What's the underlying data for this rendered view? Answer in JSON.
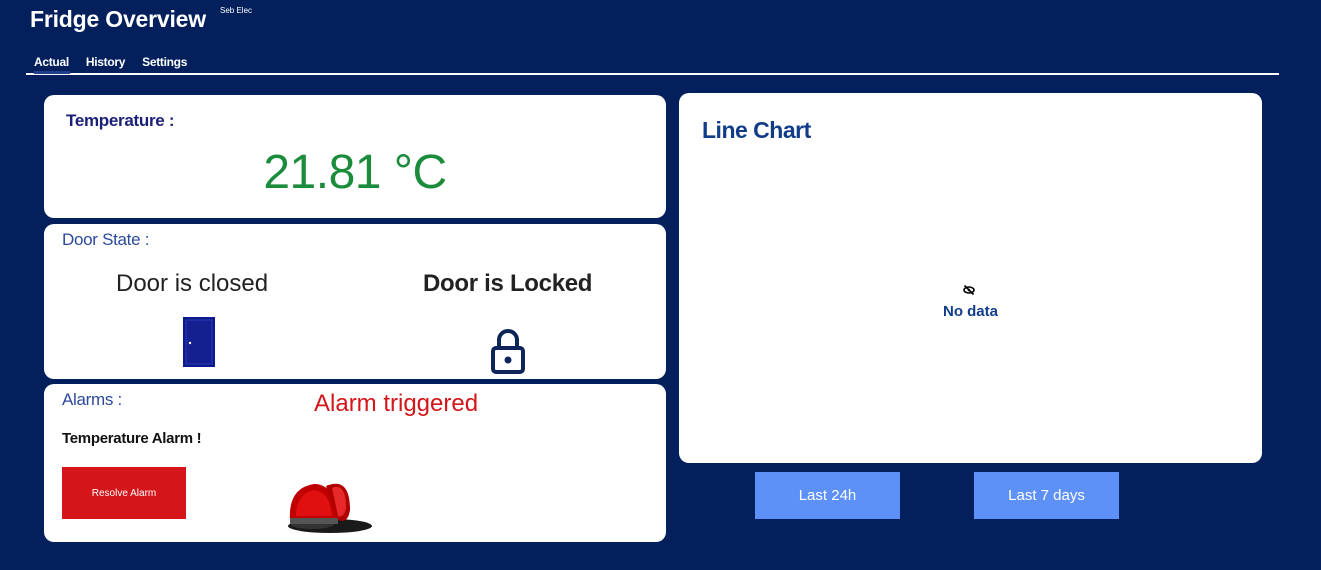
{
  "header": {
    "title": "Fridge Overview",
    "subtitle": "Seb Elec"
  },
  "tabs": [
    {
      "label": "Actual",
      "active": true
    },
    {
      "label": "History",
      "active": false
    },
    {
      "label": "Settings",
      "active": false
    }
  ],
  "temperature": {
    "label": "Temperature :",
    "value": "21.81 °C"
  },
  "door": {
    "label": "Door State :",
    "state": "Door is closed",
    "lock_state": "Door is Locked"
  },
  "alarms": {
    "label": "Alarms :",
    "status": "Alarm triggered",
    "message": "Temperature Alarm !",
    "resolve_label": "Resolve Alarm"
  },
  "chart": {
    "title": "Line Chart",
    "empty_text": "No data",
    "range_buttons": [
      "Last 24h",
      "Last 7 days"
    ]
  },
  "colors": {
    "background": "#03205c",
    "temperature_ok": "#1b8b3c",
    "alarm": "#d4151a",
    "button_blue": "#5d91f8"
  },
  "icons": {
    "door": "door-icon",
    "lock": "lock-icon",
    "siren": "siren-icon",
    "no_data": "eye-off-icon"
  }
}
